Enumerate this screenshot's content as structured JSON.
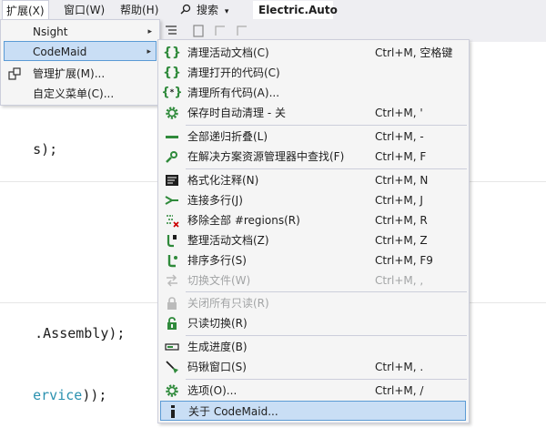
{
  "menubar": {
    "extensions": "扩展(X)",
    "window": "窗口(W)",
    "help": "帮助(H)",
    "search_icon": "search-icon",
    "search": "搜索",
    "config": "Electric.Auto"
  },
  "code": {
    "line1": "s);",
    "line2": ".Assembly);",
    "line3a": "ervice",
    "line3b": "));"
  },
  "ext_menu": {
    "items": [
      {
        "label": "Nsight",
        "icon": "",
        "arrow": "▸"
      },
      {
        "label": "CodeMaid",
        "icon": "",
        "arrow": "▸"
      },
      {
        "label": "管理扩展(M)...",
        "icon": "manage-extensions-icon"
      },
      {
        "label": "自定义菜单(C)...",
        "icon": ""
      }
    ]
  },
  "codemaid_menu": {
    "items": [
      {
        "label": "清理活动文档(C)",
        "shortcut": "Ctrl+M, 空格键",
        "icon": "braces-icon"
      },
      {
        "label": "清理打开的代码(C)",
        "shortcut": "",
        "icon": "braces-icon"
      },
      {
        "label": "清理所有代码(A)...",
        "shortcut": "",
        "icon": "braces-star-icon"
      },
      {
        "label": "保存时自动清理 - 关",
        "shortcut": "Ctrl+M, '",
        "icon": "gear-icon"
      },
      {
        "label": "全部递归折叠(L)",
        "shortcut": "Ctrl+M, -",
        "icon": "collapse-icon"
      },
      {
        "label": "在解决方案资源管理器中查找(F)",
        "shortcut": "Ctrl+M, F",
        "icon": "find-icon"
      },
      {
        "label": "格式化注释(N)",
        "shortcut": "Ctrl+M, N",
        "icon": "format-comment-icon"
      },
      {
        "label": "连接多行(J)",
        "shortcut": "Ctrl+M, J",
        "icon": "join-lines-icon"
      },
      {
        "label": "移除全部 #regions(R)",
        "shortcut": "Ctrl+M, R",
        "icon": "remove-regions-icon"
      },
      {
        "label": "整理活动文档(Z)",
        "shortcut": "Ctrl+M, Z",
        "icon": "reorganize-icon"
      },
      {
        "label": "排序多行(S)",
        "shortcut": "Ctrl+M, F9",
        "icon": "sort-lines-icon"
      },
      {
        "label": "切换文件(W)",
        "shortcut": "Ctrl+M, ,",
        "icon": "switch-file-icon"
      },
      {
        "label": "关闭所有只读(R)",
        "shortcut": "",
        "icon": "lock-icon"
      },
      {
        "label": "只读切换(R)",
        "shortcut": "",
        "icon": "unlock-icon"
      },
      {
        "label": "生成进度(B)",
        "shortcut": "",
        "icon": "progress-icon"
      },
      {
        "label": "码锹窗口(S)",
        "shortcut": "Ctrl+M, .",
        "icon": "spade-icon"
      },
      {
        "label": "选项(O)...",
        "shortcut": "Ctrl+M, /",
        "icon": "gear-icon"
      },
      {
        "label": "关于 CodeMaid...",
        "shortcut": "",
        "icon": "info-icon"
      }
    ]
  },
  "colors": {
    "accent_green": "#2f8a3b",
    "highlight_bg": "#c9def5",
    "highlight_border": "#5b9bd5",
    "type_color": "#2b91af"
  }
}
